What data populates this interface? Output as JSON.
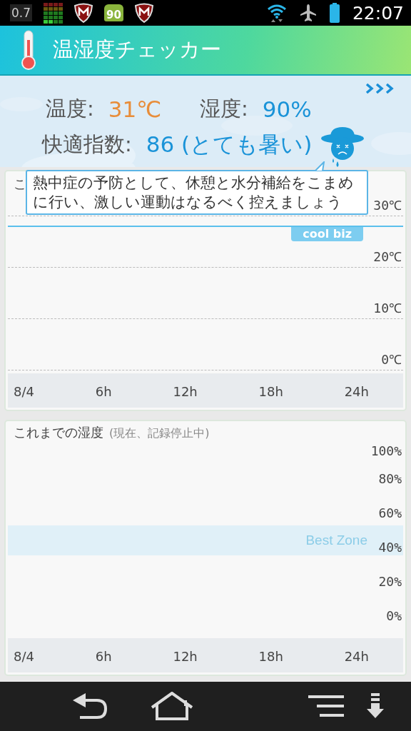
{
  "status_bar": {
    "notifications": [
      {
        "kind": "text",
        "text": "0.7"
      },
      {
        "kind": "meter"
      },
      {
        "kind": "shield"
      },
      {
        "kind": "android",
        "text": "90"
      },
      {
        "kind": "shield"
      }
    ],
    "time": "22:07"
  },
  "app_bar": {
    "title": "温湿度チェッカー"
  },
  "summary": {
    "temperature": {
      "label": "温度:",
      "value": "31℃"
    },
    "humidity": {
      "label": "湿度:",
      "value": "90%"
    },
    "comfort": {
      "label": "快適指数:",
      "value": "86 (とても暑い)"
    }
  },
  "tooltip": {
    "text": "熱中症の予防として、休憩と水分補給をこまめに行い、激しい運動はなるべく控えましょう"
  },
  "temperature_chart": {
    "title": "こ",
    "y_labels": [
      "30℃",
      "20℃",
      "10℃",
      "0℃"
    ],
    "band_label": "cool biz",
    "x_labels": [
      "8/4",
      "6h",
      "12h",
      "18h",
      "24h"
    ]
  },
  "humidity_chart": {
    "title": "これまでの湿度",
    "status": "(現在、記録停止中)",
    "y_labels": [
      "100%",
      "80%",
      "60%",
      "40%",
      "20%",
      "0%"
    ],
    "band_label": "Best Zone",
    "x_labels": [
      "8/4",
      "6h",
      "12h",
      "18h",
      "24h"
    ]
  }
}
